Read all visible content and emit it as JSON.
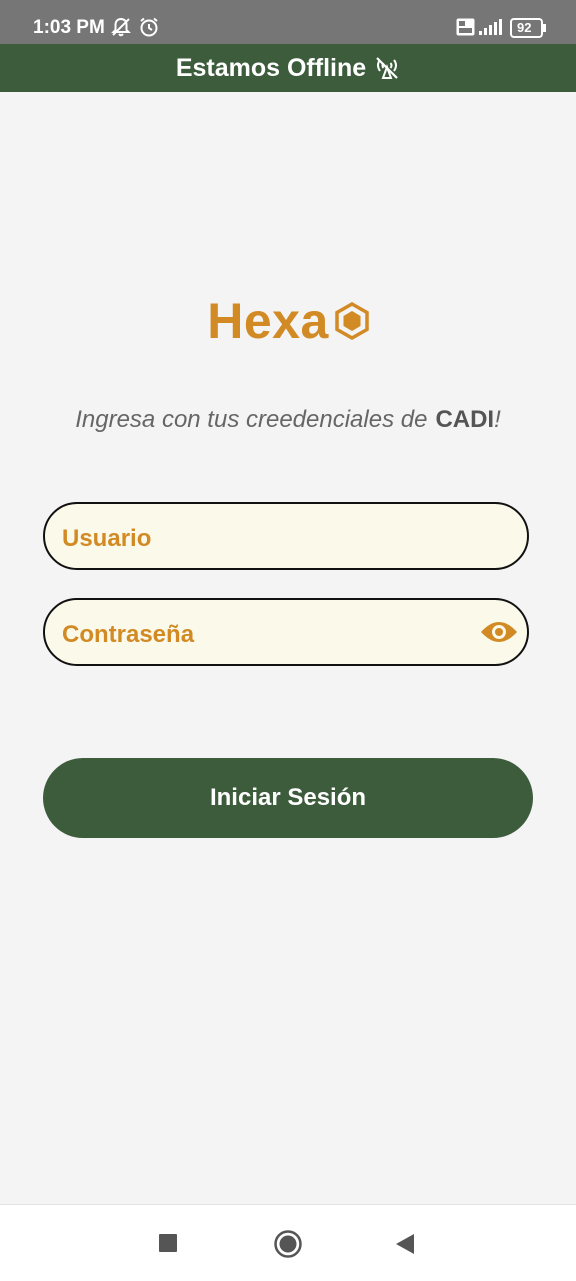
{
  "status_bar": {
    "time": "1:03 PM",
    "battery": "92",
    "icons": [
      "notification-off-icon",
      "alarm-icon",
      "volte-icon",
      "signal-icon",
      "battery-icon"
    ]
  },
  "banner": {
    "text": "Estamos Offline",
    "icon": "no-signal-icon",
    "color": "#3d5c3c"
  },
  "logo": {
    "text": "Hexa",
    "icon": "hexagon-icon",
    "color": "#d28a25"
  },
  "subtitle": {
    "text": "Ingresa con tus creedenciales de",
    "brand": "CADI",
    "suffix": "!"
  },
  "form": {
    "username_placeholder": "Usuario",
    "password_placeholder": "Contraseña",
    "field_background": "#fbfaea",
    "toggle_icon": "eye-icon"
  },
  "login_button": {
    "label": "Iniciar Sesión",
    "color": "#3d5c3c"
  },
  "nav_bar": {
    "buttons": [
      "recents-square-icon",
      "home-circle-icon",
      "back-triangle-icon"
    ]
  }
}
